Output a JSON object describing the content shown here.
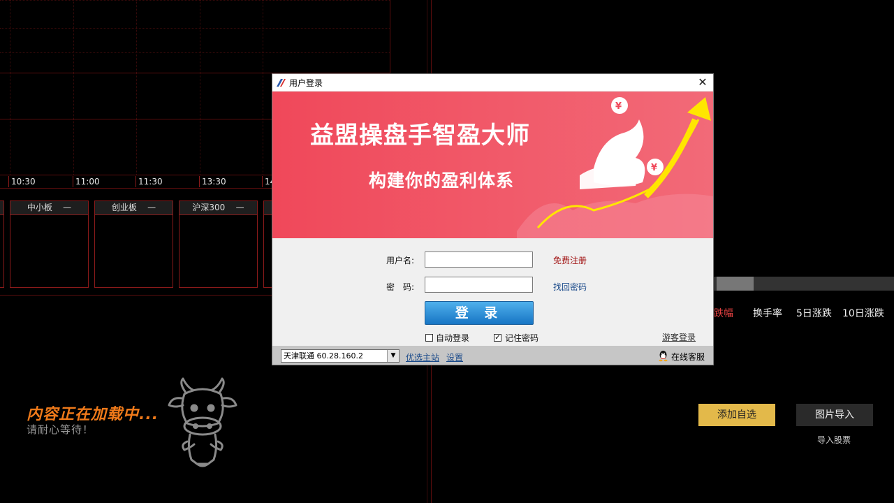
{
  "chart": {
    "time_ticks": [
      "10:30",
      "11:00",
      "11:30",
      "13:30",
      "14"
    ]
  },
  "indices": [
    {
      "name": "中小板",
      "value": "—"
    },
    {
      "name": "创业板",
      "value": "—"
    },
    {
      "name": "沪深300",
      "value": "—"
    }
  ],
  "loading": {
    "title": "内容正在加载中...",
    "subtitle": "请耐心等待！"
  },
  "table": {
    "columns": [
      "跌幅",
      "换手率",
      "5日涨跌",
      "10日涨跌"
    ]
  },
  "actions": {
    "add_watch": "添加自选",
    "import_image": "图片导入",
    "import_stock": "导入股票"
  },
  "dialog": {
    "title": "用户登录",
    "banner_title": "益盟操盘手智盈大师",
    "banner_subtitle": "构建你的盈利体系",
    "username_label": "用户名:",
    "username_value": "",
    "password_label": "密　码:",
    "password_value": "",
    "register_link": "免费注册",
    "recover_link": "找回密码",
    "login_button": "登 录",
    "auto_login": {
      "label": "自动登录",
      "checked": false
    },
    "remember_password": {
      "label": "记住密码",
      "checked": true
    },
    "guest_login": "游客登录",
    "server_select": "天津联通 60.28.160.2",
    "preferred_host": "优选主站",
    "settings": "设置",
    "online_service": "在线客服"
  },
  "colors": {
    "banner": "#f0485a",
    "login_button": "#1775c4",
    "accent_orange": "#f07a1a",
    "add_button": "#e3b94a",
    "grid_red": "#8a1a1a"
  }
}
